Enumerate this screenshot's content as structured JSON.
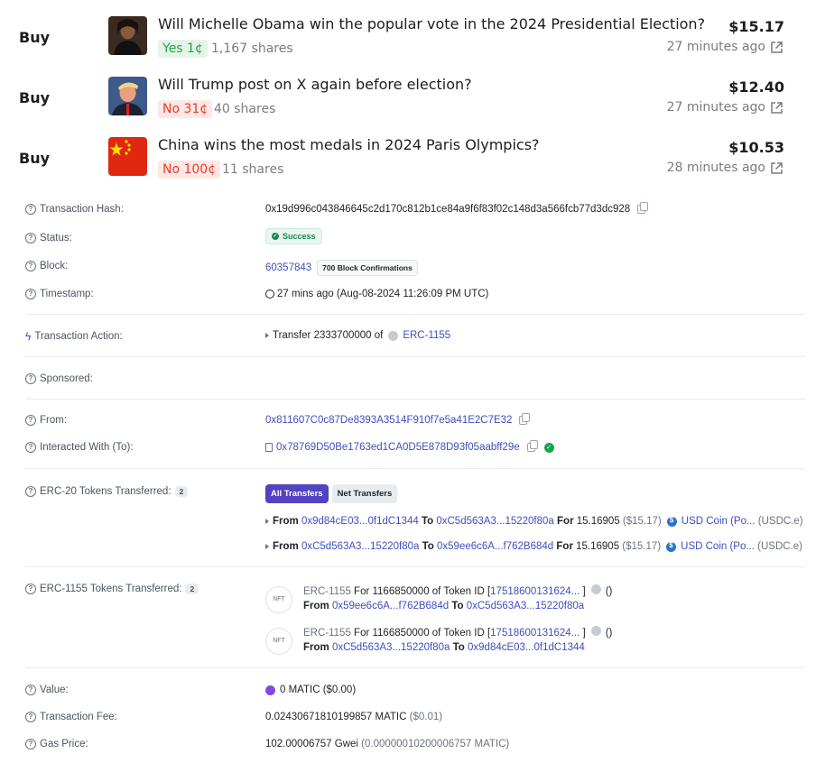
{
  "trades": [
    {
      "side": "Buy",
      "title": "Will Michelle Obama win the popular vote in the 2024 Presidential Election?",
      "outcome": "Yes 1¢",
      "outcome_type": "yes",
      "shares": "1,167 shares",
      "price": "$15.17",
      "time": "27 minutes ago",
      "avatar_icon": "portrait-avatar"
    },
    {
      "side": "Buy",
      "title": "Will Trump post on X again before election?",
      "outcome": "No 31¢",
      "outcome_type": "no",
      "shares": "40 shares",
      "price": "$12.40",
      "time": "27 minutes ago",
      "avatar_icon": "portrait-avatar"
    },
    {
      "side": "Buy",
      "title": "China wins the most medals in 2024 Paris Olympics?",
      "outcome": "No 100¢",
      "outcome_type": "no",
      "shares": "11 shares",
      "price": "$10.53",
      "time": "28 minutes ago",
      "avatar_icon": "china-flag"
    }
  ],
  "tx": {
    "hash_label": "Transaction Hash:",
    "hash": "0x19d996c043846645c2d170c812b1ce84a9f6f83f02c148d3a566fcb77d3dc928",
    "status_label": "Status:",
    "status": "Success",
    "block_label": "Block:",
    "block": "60357843",
    "confirmations": "700 Block Confirmations",
    "timestamp_label": "Timestamp:",
    "timestamp": "27 mins ago (Aug-08-2024 11:26:09 PM UTC)",
    "action_label": "Transaction Action:",
    "action_prefix": "Transfer 2333700000 of",
    "action_token": "ERC-1155",
    "sponsored_label": "Sponsored:",
    "from_label": "From:",
    "from": "0x811607C0c87De8393A3514F910f7e5a41E2C7E32",
    "to_label": "Interacted With (To):",
    "to": "0x78769D50Be1763ed1CA0D5E878D93f05aabff29e",
    "erc20_label": "ERC-20 Tokens Transferred:",
    "erc20_count": "2",
    "erc20_tabs": [
      "All Transfers",
      "Net Transfers"
    ],
    "erc20_transfers": [
      {
        "from": "0x9d84cE03...0f1dC1344",
        "to": "0xC5d563A3...15220f80a",
        "amount": "15.16905",
        "usd": "($15.17)",
        "token": "USD Coin (Po...",
        "symbol": "(USDC.e)"
      },
      {
        "from": "0xC5d563A3...15220f80a",
        "to": "0x59ee6c6A...f762B684d",
        "amount": "15.16905",
        "usd": "($15.17)",
        "token": "USD Coin (Po...",
        "symbol": "(USDC.e)"
      }
    ],
    "erc1155_label": "ERC-1155 Tokens Transferred:",
    "erc1155_count": "2",
    "erc1155_transfers": [
      {
        "prefix": "ERC-1155",
        "for_text": "For 1166850000 of Token ID [",
        "token_id": "17518600131624...",
        "close": "]",
        "paren": "()",
        "from": "0x59ee6c6A...f762B684d",
        "to": "0xC5d563A3...15220f80a"
      },
      {
        "prefix": "ERC-1155",
        "for_text": "For 1166850000 of Token ID [",
        "token_id": "17518600131624...",
        "close": "]",
        "paren": "()",
        "from": "0xC5d563A3...15220f80a",
        "to": "0x9d84cE03...0f1dC1344"
      }
    ],
    "nft_icon_text": "NFT",
    "value_label": "Value:",
    "value": "0 MATIC ($0.00)",
    "fee_label": "Transaction Fee:",
    "fee": "0.02430671810199857 MATIC",
    "fee_usd": "($0.01)",
    "gas_label": "Gas Price:",
    "gas": "102.00006757 Gwei",
    "gas_matic": "(0.00000010200006757 MATIC)"
  },
  "words": {
    "from": "From",
    "to": "To",
    "for": "For"
  }
}
